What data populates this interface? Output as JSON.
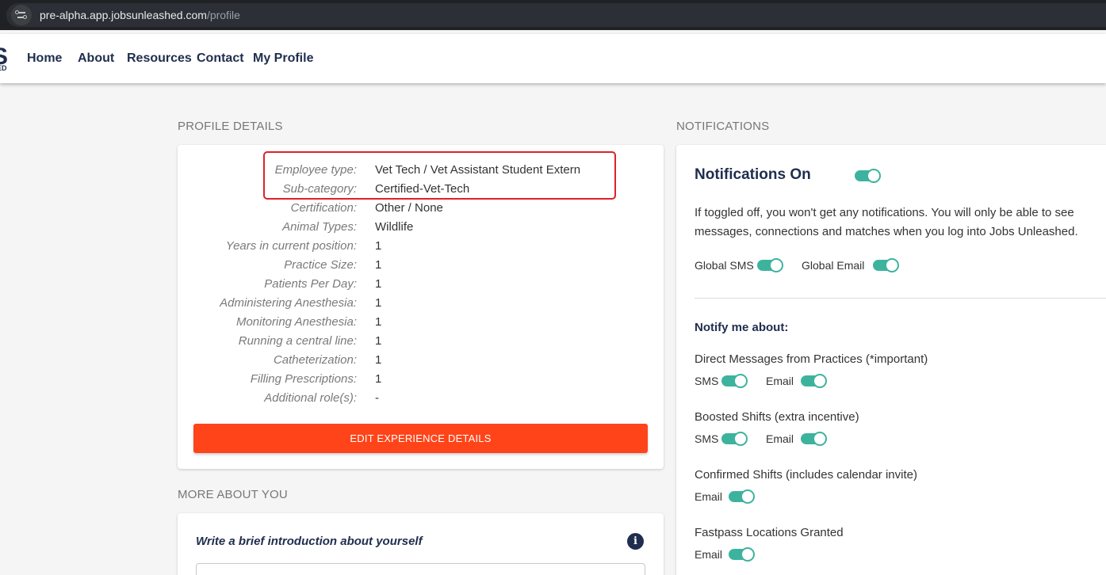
{
  "browser": {
    "url_host": "pre-alpha.app.jobsunleashed.com",
    "url_path": "/profile"
  },
  "nav": {
    "logo_letter": "S",
    "logo_sub": "ED",
    "items": [
      "Home",
      "About",
      "Resources",
      "Contact",
      "My Profile"
    ]
  },
  "profile": {
    "section_label": "PROFILE DETAILS",
    "rows": [
      {
        "key": "Employee type:",
        "value": "Vet Tech / Vet Assistant Student Extern"
      },
      {
        "key": "Sub-category:",
        "value": "Certified-Vet-Tech"
      },
      {
        "key": "Certification:",
        "value": "Other / None"
      },
      {
        "key": "Animal Types:",
        "value": "Wildlife"
      },
      {
        "key": "Years in current position:",
        "value": "1"
      },
      {
        "key": "Practice Size:",
        "value": "1"
      },
      {
        "key": "Patients Per Day:",
        "value": "1"
      },
      {
        "key": "Administering Anesthesia:",
        "value": "1"
      },
      {
        "key": "Monitoring Anesthesia:",
        "value": "1"
      },
      {
        "key": "Running a central line:",
        "value": "1"
      },
      {
        "key": "Catheterization:",
        "value": "1"
      },
      {
        "key": "Filling Prescriptions:",
        "value": "1"
      },
      {
        "key": "Additional role(s):",
        "value": "-"
      }
    ],
    "edit_button": "EDIT EXPERIENCE DETAILS"
  },
  "more": {
    "section_label": "MORE ABOUT YOU",
    "intro_title": "Write a brief introduction about yourself",
    "info_icon_glyph": "i"
  },
  "notifications": {
    "section_label": "NOTIFICATIONS",
    "title": "Notifications On",
    "master_on": true,
    "description": "If toggled off, you won't get any notifications. You will only be able to see messages, connections and matches when you log into Jobs Unleashed.",
    "global_sms": "Global SMS",
    "global_email": "Global Email",
    "notify_head": "Notify me about:",
    "items": [
      {
        "label": "Direct Messages from Practices (*important)",
        "sms": "SMS",
        "email": "Email"
      },
      {
        "label": "Boosted Shifts (extra incentive)",
        "sms": "SMS",
        "email": "Email"
      },
      {
        "label": "Confirmed Shifts (includes calendar invite)",
        "email": "Email"
      },
      {
        "label": "Fastpass Locations Granted",
        "email": "Email"
      }
    ]
  },
  "colors": {
    "accent": "#3db39e",
    "brand": "#1f2d4e",
    "button": "#ff4419",
    "highlight": "#e0202a"
  }
}
